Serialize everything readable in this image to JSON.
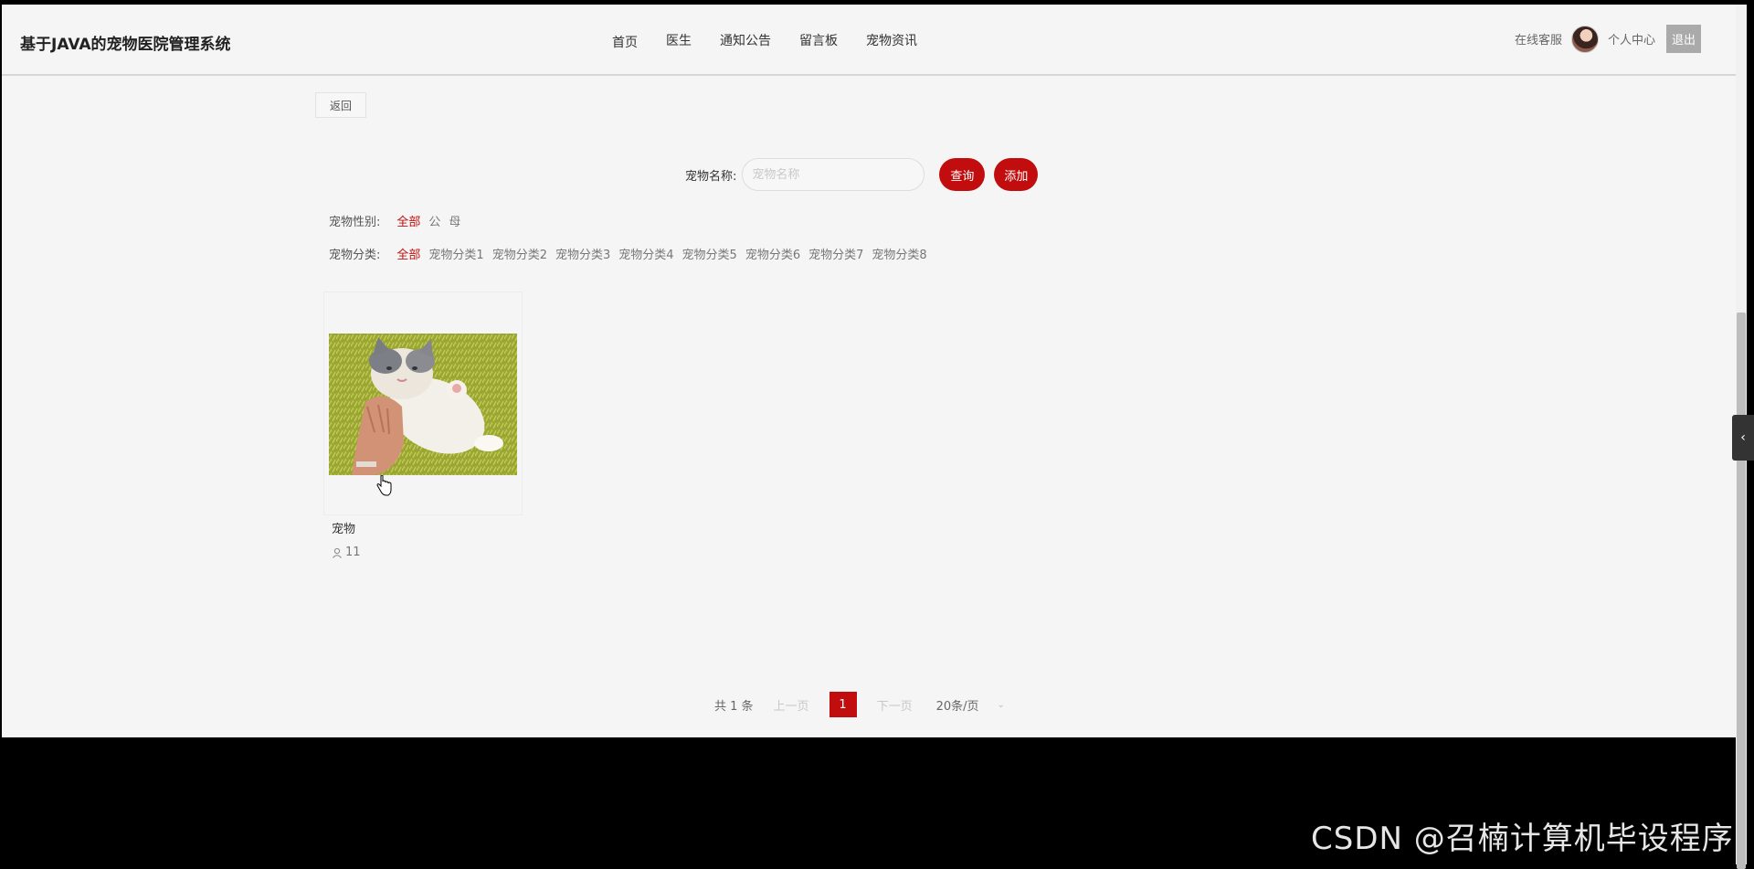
{
  "header": {
    "app_title": "基于JAVA的宠物医院管理系统",
    "nav": [
      "首页",
      "医生",
      "通知公告",
      "留言板",
      "宠物资讯"
    ],
    "online_service": "在线客服",
    "profile": "个人中心",
    "logout": "退出"
  },
  "back_label": "返回",
  "search": {
    "label": "宠物名称:",
    "placeholder": "宠物名称",
    "query_label": "查询",
    "add_label": "添加"
  },
  "filters": {
    "gender": {
      "label": "宠物性别:",
      "options": [
        "全部",
        "公",
        "母"
      ],
      "active": "全部"
    },
    "category": {
      "label": "宠物分类:",
      "options": [
        "全部",
        "宠物分类1",
        "宠物分类2",
        "宠物分类3",
        "宠物分类4",
        "宠物分类5",
        "宠物分类6",
        "宠物分类7",
        "宠物分类8"
      ],
      "active": "全部"
    }
  },
  "items": [
    {
      "name": "宠物",
      "count": "11"
    }
  ],
  "pagination": {
    "total": "共 1 条",
    "prev": "上一页",
    "current": "1",
    "next": "下一页",
    "page_size": "20条/页"
  },
  "watermark": "CSDN @召楠计算机毕设程序",
  "colors": {
    "accent": "#c10d0d",
    "background": "#f5f5f5"
  }
}
